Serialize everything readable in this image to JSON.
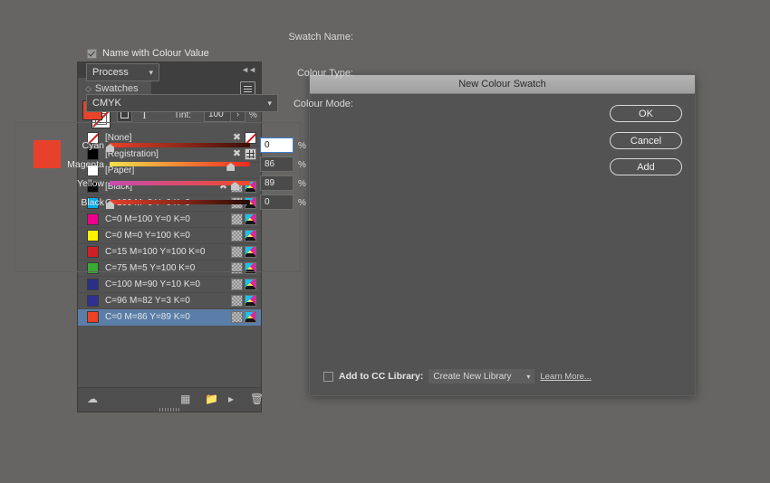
{
  "panel": {
    "tab_label": "Swatches",
    "close_icon": "×",
    "collapse_icon": "◄◄",
    "toolbar": {
      "tint_label": "Tint:",
      "tint_value": "100",
      "tint_stepper": "›",
      "percent": "%",
      "text_tile": "T"
    },
    "swatches": [
      {
        "name": "[None]",
        "color": "none",
        "icons": [
          "spot",
          "none-preview"
        ]
      },
      {
        "name": "[Registration]",
        "color": "#000000",
        "icons": [
          "spot",
          "registration"
        ]
      },
      {
        "name": "[Paper]",
        "color": "#ffffff",
        "icons": []
      },
      {
        "name": "[Black]",
        "color": "#0d0d0d",
        "icons": [
          "spot",
          "grid",
          "cmyk"
        ]
      },
      {
        "name": "C=100 M=0 Y=0 K=0",
        "color": "#00aeef",
        "icons": [
          "grid",
          "cmyk"
        ]
      },
      {
        "name": "C=0 M=100 Y=0 K=0",
        "color": "#ec008c",
        "icons": [
          "grid",
          "cmyk"
        ]
      },
      {
        "name": "C=0 M=0 Y=100 K=0",
        "color": "#fff200",
        "icons": [
          "grid",
          "cmyk"
        ]
      },
      {
        "name": "C=15 M=100 Y=100 K=0",
        "color": "#cf2027",
        "icons": [
          "grid",
          "cmyk"
        ]
      },
      {
        "name": "C=75 M=5 Y=100 K=0",
        "color": "#3aaa35",
        "icons": [
          "grid",
          "cmyk"
        ]
      },
      {
        "name": "C=100 M=90 Y=10 K=0",
        "color": "#2b3087",
        "icons": [
          "grid",
          "cmyk"
        ]
      },
      {
        "name": "C=96 M=82 Y=3 K=0",
        "color": "#2e3192",
        "icons": [
          "grid",
          "cmyk"
        ]
      },
      {
        "name": "C=0 M=86 Y=89 K=0",
        "color": "#ef4123",
        "icons": [
          "grid",
          "cmyk"
        ],
        "selected": true
      }
    ],
    "footer_icons": [
      "cc-library-icon",
      "new-colour-group-icon",
      "new-swatch-group-icon",
      "new-swatch-icon",
      "delete-swatch-icon"
    ]
  },
  "dialog": {
    "title": "New Colour Swatch",
    "swatch_name_label": "Swatch Name:",
    "name_with_value_label": "Name with Colour Value",
    "name_with_value_checked": true,
    "colour_type_label": "Colour Type:",
    "colour_type_value": "Process",
    "colour_mode_label": "Colour Mode:",
    "colour_mode_value": "CMYK",
    "preview_color": "#e8412b",
    "sliders": [
      {
        "label": "Cyan",
        "value": "0",
        "pct": "%",
        "focused": true,
        "track_start": "#e8412b",
        "track_end": "#3b1008"
      },
      {
        "label": "Magenta",
        "value": "86",
        "pct": "%",
        "focused": false,
        "track_start": "#f3e24a",
        "track_end": "#ed2a20"
      },
      {
        "label": "Yellow",
        "value": "89",
        "pct": "%",
        "focused": false,
        "track_start": "#c74bb0",
        "track_end": "#ef4b2a"
      },
      {
        "label": "Black",
        "value": "0",
        "pct": "%",
        "focused": false,
        "track_start": "#e8412b",
        "track_end": "#2a0b05"
      }
    ],
    "buttons": [
      {
        "label": "OK"
      },
      {
        "label": "Cancel"
      },
      {
        "label": "Add"
      }
    ],
    "cc_library": {
      "checkbox_checked": false,
      "label": "Add to CC Library:",
      "dropdown_value": "Create New Library",
      "learn_more": "Learn More..."
    }
  }
}
